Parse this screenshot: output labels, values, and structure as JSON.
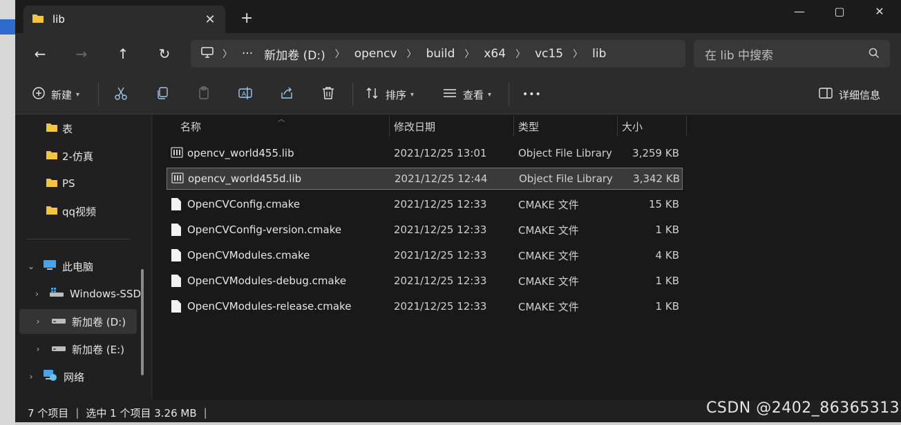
{
  "window": {
    "tab_title": "lib",
    "tab_close": "✕",
    "new_tab": "+",
    "controls": {
      "minimize": "—",
      "maximize": "▢",
      "close": "✕"
    }
  },
  "nav": {
    "back": "←",
    "forward": "→",
    "up": "↑",
    "refresh": "↻",
    "more_crumbs": "···",
    "breadcrumbs": [
      "新加卷 (D:)",
      "opencv",
      "build",
      "x64",
      "vc15",
      "lib"
    ],
    "search_placeholder": "在 lib 中搜索"
  },
  "toolbar": {
    "new_label": "新建",
    "sort_label": "排序",
    "view_label": "查看",
    "more": "•••",
    "details_label": "详细信息"
  },
  "sidebar": {
    "items": [
      {
        "label": "表",
        "icon": "folder-icon"
      },
      {
        "label": "2-仿真",
        "icon": "folder-icon"
      },
      {
        "label": "PS",
        "icon": "folder-icon"
      },
      {
        "label": "qq视频",
        "icon": "folder-icon"
      },
      {
        "label": "此电脑",
        "icon": "computer-icon"
      },
      {
        "label": "Windows-SSD",
        "icon": "windows-drive-icon"
      },
      {
        "label": "新加卷 (D:)",
        "icon": "drive-icon"
      },
      {
        "label": "新加卷 (E:)",
        "icon": "drive-icon"
      },
      {
        "label": "网络",
        "icon": "network-icon"
      }
    ]
  },
  "columns": {
    "name": "名称",
    "date": "修改日期",
    "type": "类型",
    "size": "大小"
  },
  "files": [
    {
      "name": "opencv_world455.lib",
      "date": "2021/12/25 13:01",
      "type": "Object File Library",
      "size": "3,259 KB"
    },
    {
      "name": "opencv_world455d.lib",
      "date": "2021/12/25 12:44",
      "type": "Object File Library",
      "size": "3,342 KB"
    },
    {
      "name": "OpenCVConfig.cmake",
      "date": "2021/12/25 12:33",
      "type": "CMAKE 文件",
      "size": "15 KB"
    },
    {
      "name": "OpenCVConfig-version.cmake",
      "date": "2021/12/25 12:33",
      "type": "CMAKE 文件",
      "size": "1 KB"
    },
    {
      "name": "OpenCVModules.cmake",
      "date": "2021/12/25 12:33",
      "type": "CMAKE 文件",
      "size": "4 KB"
    },
    {
      "name": "OpenCVModules-debug.cmake",
      "date": "2021/12/25 12:33",
      "type": "CMAKE 文件",
      "size": "1 KB"
    },
    {
      "name": "OpenCVModules-release.cmake",
      "date": "2021/12/25 12:33",
      "type": "CMAKE 文件",
      "size": "1 KB"
    }
  ],
  "status": {
    "count": "7 个项目",
    "selection": "选中 1 个项目 3.26 MB",
    "separator": "|"
  },
  "watermark": "CSDN @2402_86365313",
  "colors": {
    "background": "#191919",
    "folder": "#f4c542",
    "selected": "#3a3a3a"
  }
}
